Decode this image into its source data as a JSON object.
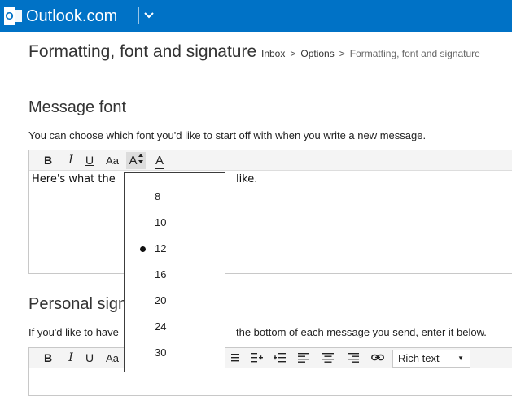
{
  "app": {
    "brand": "Outlook.com",
    "logo_letter": "O"
  },
  "header": {
    "title": "Formatting, font and signature",
    "breadcrumb": {
      "items": [
        "Inbox",
        "Options",
        "Formatting, font and signature"
      ],
      "separator": ">"
    }
  },
  "message_font": {
    "title": "Message font",
    "description": "You can choose which font you'd like to start off with when you write a new message.",
    "preview_left": "Here's what the",
    "preview_right": "like.",
    "toolbar": {
      "bold": "B",
      "italic": "I",
      "underline": "U",
      "font": "Aa",
      "font_size": "A",
      "font_color": "A"
    }
  },
  "font_size_menu": {
    "options": [
      "8",
      "10",
      "12",
      "16",
      "20",
      "24",
      "30"
    ],
    "selected": "12"
  },
  "personal_signature": {
    "title": "Personal sign",
    "description_left": "If you'd like to have",
    "description_right": "the bottom of each message you send, enter it below.",
    "toolbar": {
      "bold": "B",
      "italic": "I",
      "underline": "U",
      "font": "Aa",
      "format_select": "Rich text"
    }
  },
  "colors": {
    "brand_blue": "#0072c6",
    "popup_border": "#3c3c3c"
  }
}
